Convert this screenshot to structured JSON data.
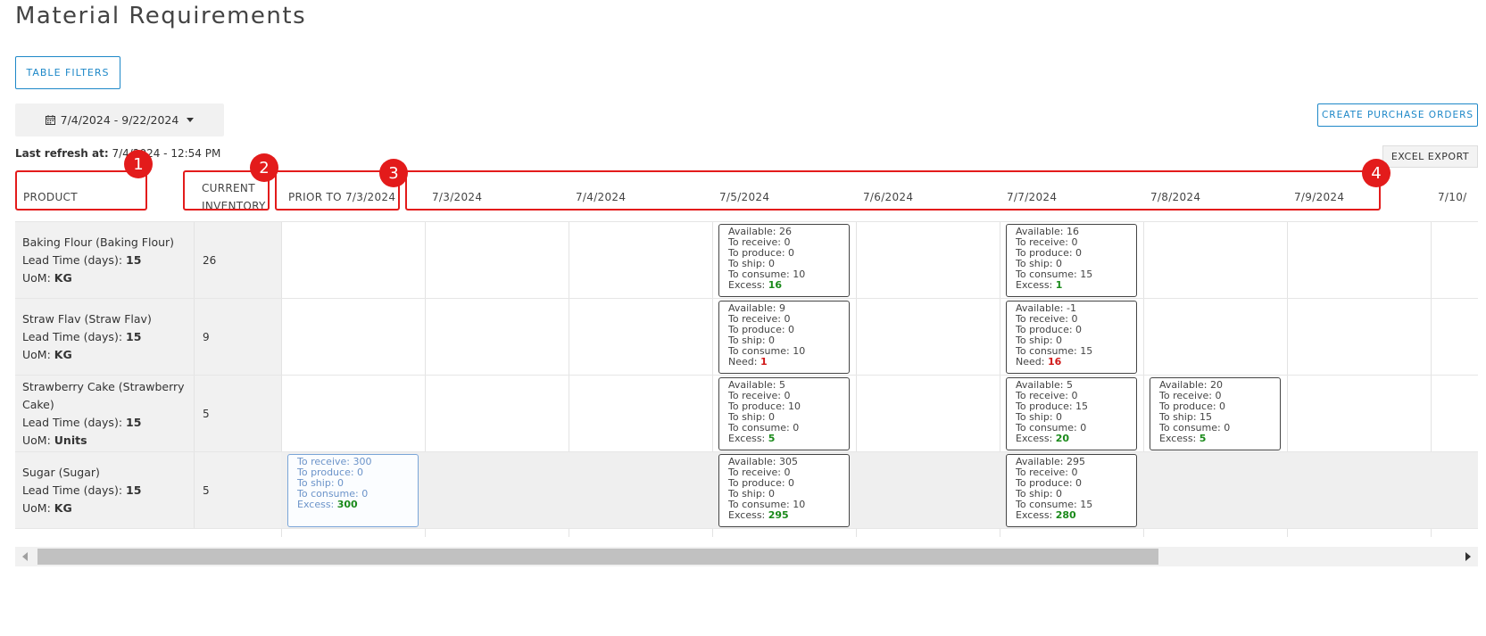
{
  "page": {
    "title": "Material Requirements",
    "table_filters_label": "TABLE FILTERS",
    "date_range": "7/4/2024 - 9/22/2024",
    "last_refresh_label": "Last refresh at:",
    "last_refresh_value": "7/4/2024 - 12:54 PM",
    "create_po_label": "CREATE PURCHASE ORDERS",
    "excel_export_label": "EXCEL EXPORT"
  },
  "headers": {
    "product": "PRODUCT",
    "inventory_line1": "CURRENT",
    "inventory_line2": "INVENTORY",
    "prior": "PRIOR TO 7/3/2024",
    "dates": [
      "7/3/2024",
      "7/4/2024",
      "7/5/2024",
      "7/6/2024",
      "7/7/2024",
      "7/8/2024",
      "7/9/2024",
      "7/10/"
    ]
  },
  "annotations": [
    "1",
    "2",
    "3",
    "4"
  ],
  "rows": [
    {
      "name": "Baking Flour (Baking Flour)",
      "lead_label": "Lead Time (days):",
      "lead": "15",
      "uom_label": "UoM:",
      "uom": "KG",
      "inventory": "26",
      "cards": [
        {
          "col": 3,
          "available": "26",
          "receive": "0",
          "produce": "0",
          "ship": "0",
          "consume": "10",
          "result_label": "Excess:",
          "result": "16",
          "kind": "excess"
        },
        {
          "col": 5,
          "available": "16",
          "receive": "0",
          "produce": "0",
          "ship": "0",
          "consume": "15",
          "result_label": "Excess:",
          "result": "1",
          "kind": "excess"
        }
      ]
    },
    {
      "name": "Straw Flav (Straw Flav)",
      "lead_label": "Lead Time (days):",
      "lead": "15",
      "uom_label": "UoM:",
      "uom": "KG",
      "inventory": "9",
      "cards": [
        {
          "col": 3,
          "available": "9",
          "receive": "0",
          "produce": "0",
          "ship": "0",
          "consume": "10",
          "result_label": "Need:",
          "result": "1",
          "kind": "need"
        },
        {
          "col": 5,
          "available": "-1",
          "receive": "0",
          "produce": "0",
          "ship": "0",
          "consume": "15",
          "result_label": "Need:",
          "result": "16",
          "kind": "need"
        }
      ]
    },
    {
      "name": "Strawberry Cake (Strawberry Cake)",
      "lead_label": "Lead Time (days):",
      "lead": "15",
      "uom_label": "UoM:",
      "uom": "Units",
      "inventory": "5",
      "cards": [
        {
          "col": 3,
          "available": "5",
          "receive": "0",
          "produce": "10",
          "ship": "0",
          "consume": "0",
          "result_label": "Excess:",
          "result": "5",
          "kind": "excess"
        },
        {
          "col": 5,
          "available": "5",
          "receive": "0",
          "produce": "15",
          "ship": "0",
          "consume": "0",
          "result_label": "Excess:",
          "result": "20",
          "kind": "excess"
        },
        {
          "col": 6,
          "available": "20",
          "receive": "0",
          "produce": "0",
          "ship": "15",
          "consume": "0",
          "result_label": "Excess:",
          "result": "5",
          "kind": "excess"
        }
      ]
    },
    {
      "name": "Sugar (Sugar)",
      "lead_label": "Lead Time (days):",
      "lead": "15",
      "uom_label": "UoM:",
      "uom": "KG",
      "inventory": "5",
      "cards": [
        {
          "col": 0,
          "receive": "300",
          "produce": "0",
          "ship": "0",
          "consume": "0",
          "result_label": "Excess:",
          "result": "300",
          "kind": "excess",
          "prior": true
        },
        {
          "col": 3,
          "available": "305",
          "receive": "0",
          "produce": "0",
          "ship": "0",
          "consume": "10",
          "result_label": "Excess:",
          "result": "295",
          "kind": "excess"
        },
        {
          "col": 5,
          "available": "295",
          "receive": "0",
          "produce": "0",
          "ship": "0",
          "consume": "15",
          "result_label": "Excess:",
          "result": "280",
          "kind": "excess"
        }
      ]
    }
  ],
  "card_labels": {
    "available": "Available:",
    "receive": "To receive:",
    "produce": "To produce:",
    "ship": "To ship:",
    "consume": "To consume:"
  }
}
